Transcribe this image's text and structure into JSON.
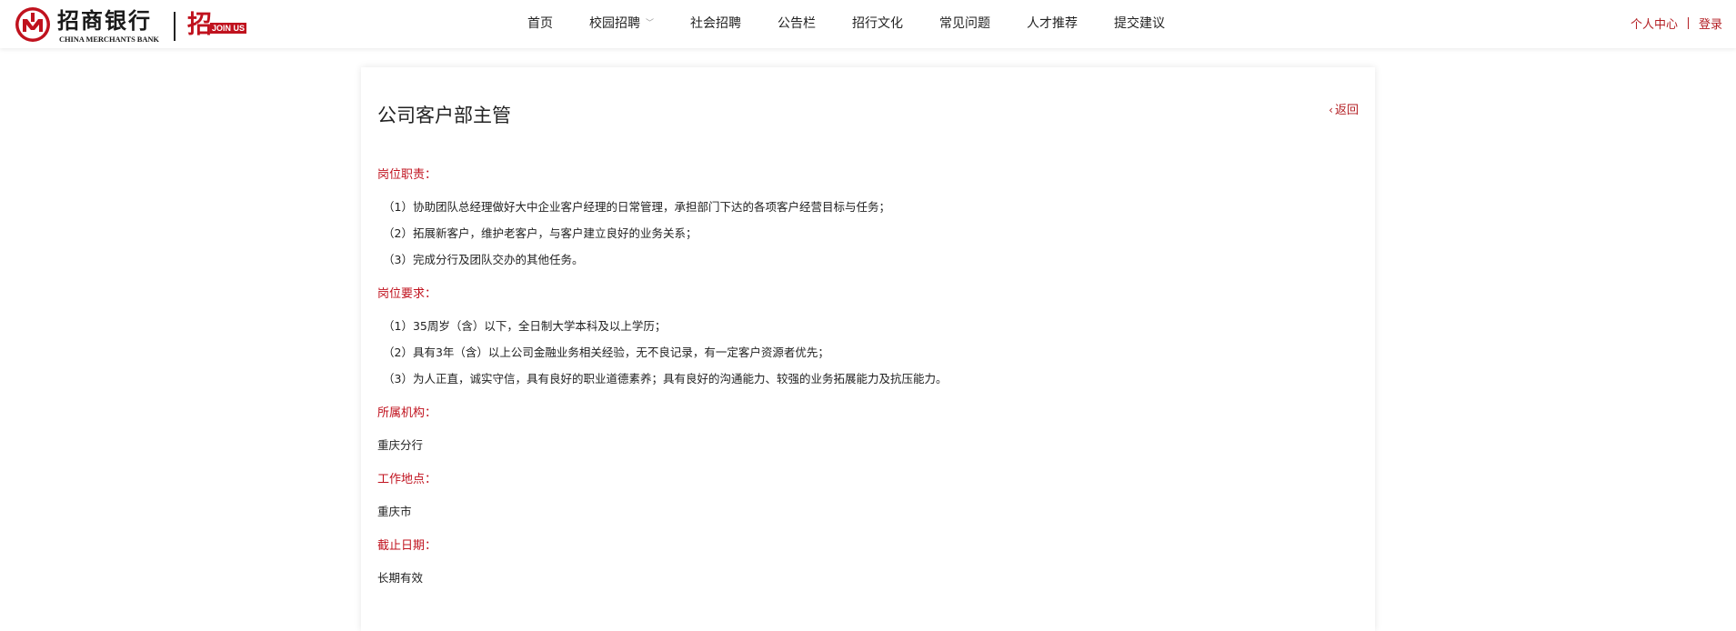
{
  "header": {
    "logo": {
      "cn_text": "招商银行",
      "en_text": "CHINA MERCHANTS BANK",
      "join_char": "招",
      "join_badge": "JOIN US"
    },
    "nav": [
      {
        "label": "首页",
        "has_dropdown": false
      },
      {
        "label": "校园招聘",
        "has_dropdown": true
      },
      {
        "label": "社会招聘",
        "has_dropdown": false
      },
      {
        "label": "公告栏",
        "has_dropdown": false
      },
      {
        "label": "招行文化",
        "has_dropdown": false
      },
      {
        "label": "常见问题",
        "has_dropdown": false
      },
      {
        "label": "人才推荐",
        "has_dropdown": false
      },
      {
        "label": "提交建议",
        "has_dropdown": false
      }
    ],
    "user_center": "个人中心",
    "login": "登录"
  },
  "job": {
    "title": "公司客户部主管",
    "back": "返回",
    "duties_label": "岗位职责：",
    "duties": [
      "（1）协助团队总经理做好大中企业客户经理的日常管理，承担部门下达的各项客户经营目标与任务；",
      "（2）拓展新客户，维护老客户，与客户建立良好的业务关系；",
      "（3）完成分行及团队交办的其他任务。"
    ],
    "requirements_label": "岗位要求：",
    "requirements": [
      "（1）35周岁（含）以下，全日制大学本科及以上学历；",
      "（2）具有3年（含）以上公司金融业务相关经验，无不良记录，有一定客户资源者优先；",
      "（3）为人正直，诚实守信，具有良好的职业道德素养；具有良好的沟通能力、较强的业务拓展能力及抗压能力。"
    ],
    "org_label": "所属机构：",
    "org": "重庆分行",
    "location_label": "工作地点：",
    "location": "重庆市",
    "deadline_label": "截止日期：",
    "deadline": "长期有效"
  },
  "colors": {
    "brand_red": "#c0121e",
    "link_red": "#b31e23",
    "text": "#222222"
  }
}
